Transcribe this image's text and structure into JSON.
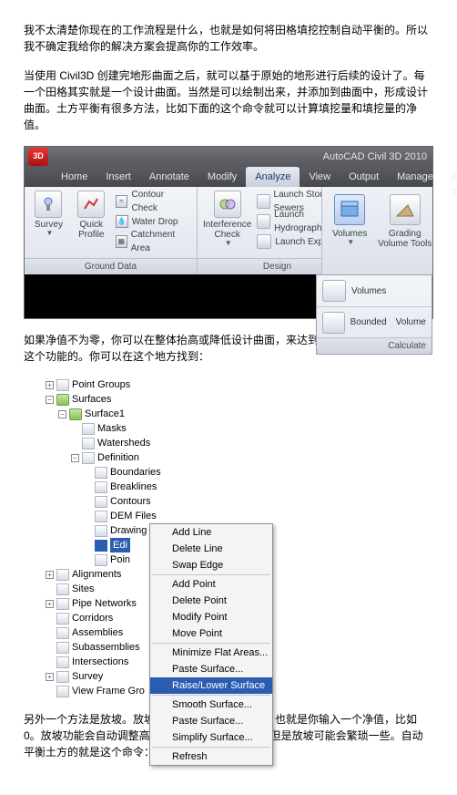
{
  "paragraphs": {
    "p1": "我不太清楚你现在的工作流程是什么，也就是如何将田格填挖控制自动平衡的。所以我不确定我给你的解决方案会提高你的工作效率。",
    "p2": "当使用 Civil3D 创建完地形曲面之后，就可以基于原始的地形进行后续的设计了。每一个田格其实就是一个设计曲面。当然是可以绘制出来，并添加到曲面中，形成设计曲面。土方平衡有很多方法，比如下面的这个命令就可以计算填挖量和填挖量的净值。",
    "p3": "如果净值不为零，你可以在整体抬高或降低设计曲面，来达到平衡的目的。曲面是有这个功能的。你可以在这个地方找到：",
    "p4": "另外一个方法是放坡。放坡有自动平衡土方的功能，也就是你输入一个净值，比如 0。放坡功能会自动调整高度，来达到平衡的目的。但是放坡可能会繁琐一些。自动平衡土方的就是这个命令："
  },
  "ribbon": {
    "app_title": "AutoCAD Civil 3D 2010",
    "logo": "3D",
    "tabs": [
      "Home",
      "Insert",
      "Annotate",
      "Modify",
      "Analyze",
      "View",
      "Output",
      "Manage",
      "Express Tools"
    ],
    "panel1": {
      "btn1": "Survey",
      "btn2": "Quick Profile",
      "row1": "Contour Check",
      "row2": "Water Drop",
      "row3": "Catchment Area",
      "footer": "Ground Data"
    },
    "panel2": {
      "btn": "Interference Check",
      "row1": "Launch Storm Sewers",
      "row2": "Launch Hydrographs",
      "row3": "Launch Express",
      "footer": "Design"
    },
    "vols": {
      "btn1": "Volumes",
      "btn2": "Grading Volume Tools",
      "drop1": "Volumes",
      "drop2a": "Bounded",
      "drop2b": "Volume",
      "footer": "Calculate"
    }
  },
  "tree": {
    "n_pointgroups": "Point Groups",
    "n_surfaces": "Surfaces",
    "n_surface1": "Surface1",
    "n_masks": "Masks",
    "n_watersheds": "Watersheds",
    "n_definition": "Definition",
    "n_boundaries": "Boundaries",
    "n_breaklines": "Breaklines",
    "n_contours": "Contours",
    "n_demfiles": "DEM Files",
    "n_drawingobj": "Drawing Objects",
    "n_edits": "Edi",
    "n_point": "Poin",
    "n_alignments": "Alignments",
    "n_sites": "Sites",
    "n_pipenet": "Pipe Networks",
    "n_corridors": "Corridors",
    "n_assemblies": "Assemblies",
    "n_subassemblies": "Subassemblies",
    "n_intersections": "Intersections",
    "n_survey": "Survey",
    "n_viewframe": "View Frame Gro"
  },
  "menu": {
    "m1": "Add Line",
    "m2": "Delete Line",
    "m3": "Swap Edge",
    "m4": "Add Point",
    "m5": "Delete Point",
    "m6": "Modify Point",
    "m7": "Move Point",
    "m8": "Minimize Flat Areas...",
    "m9": "Paste Surface...",
    "m10": "Raise/Lower Surface",
    "m11": "Smooth Surface...",
    "m12": "Paste Surface...",
    "m13": "Simplify Surface...",
    "m14": "Refresh"
  }
}
